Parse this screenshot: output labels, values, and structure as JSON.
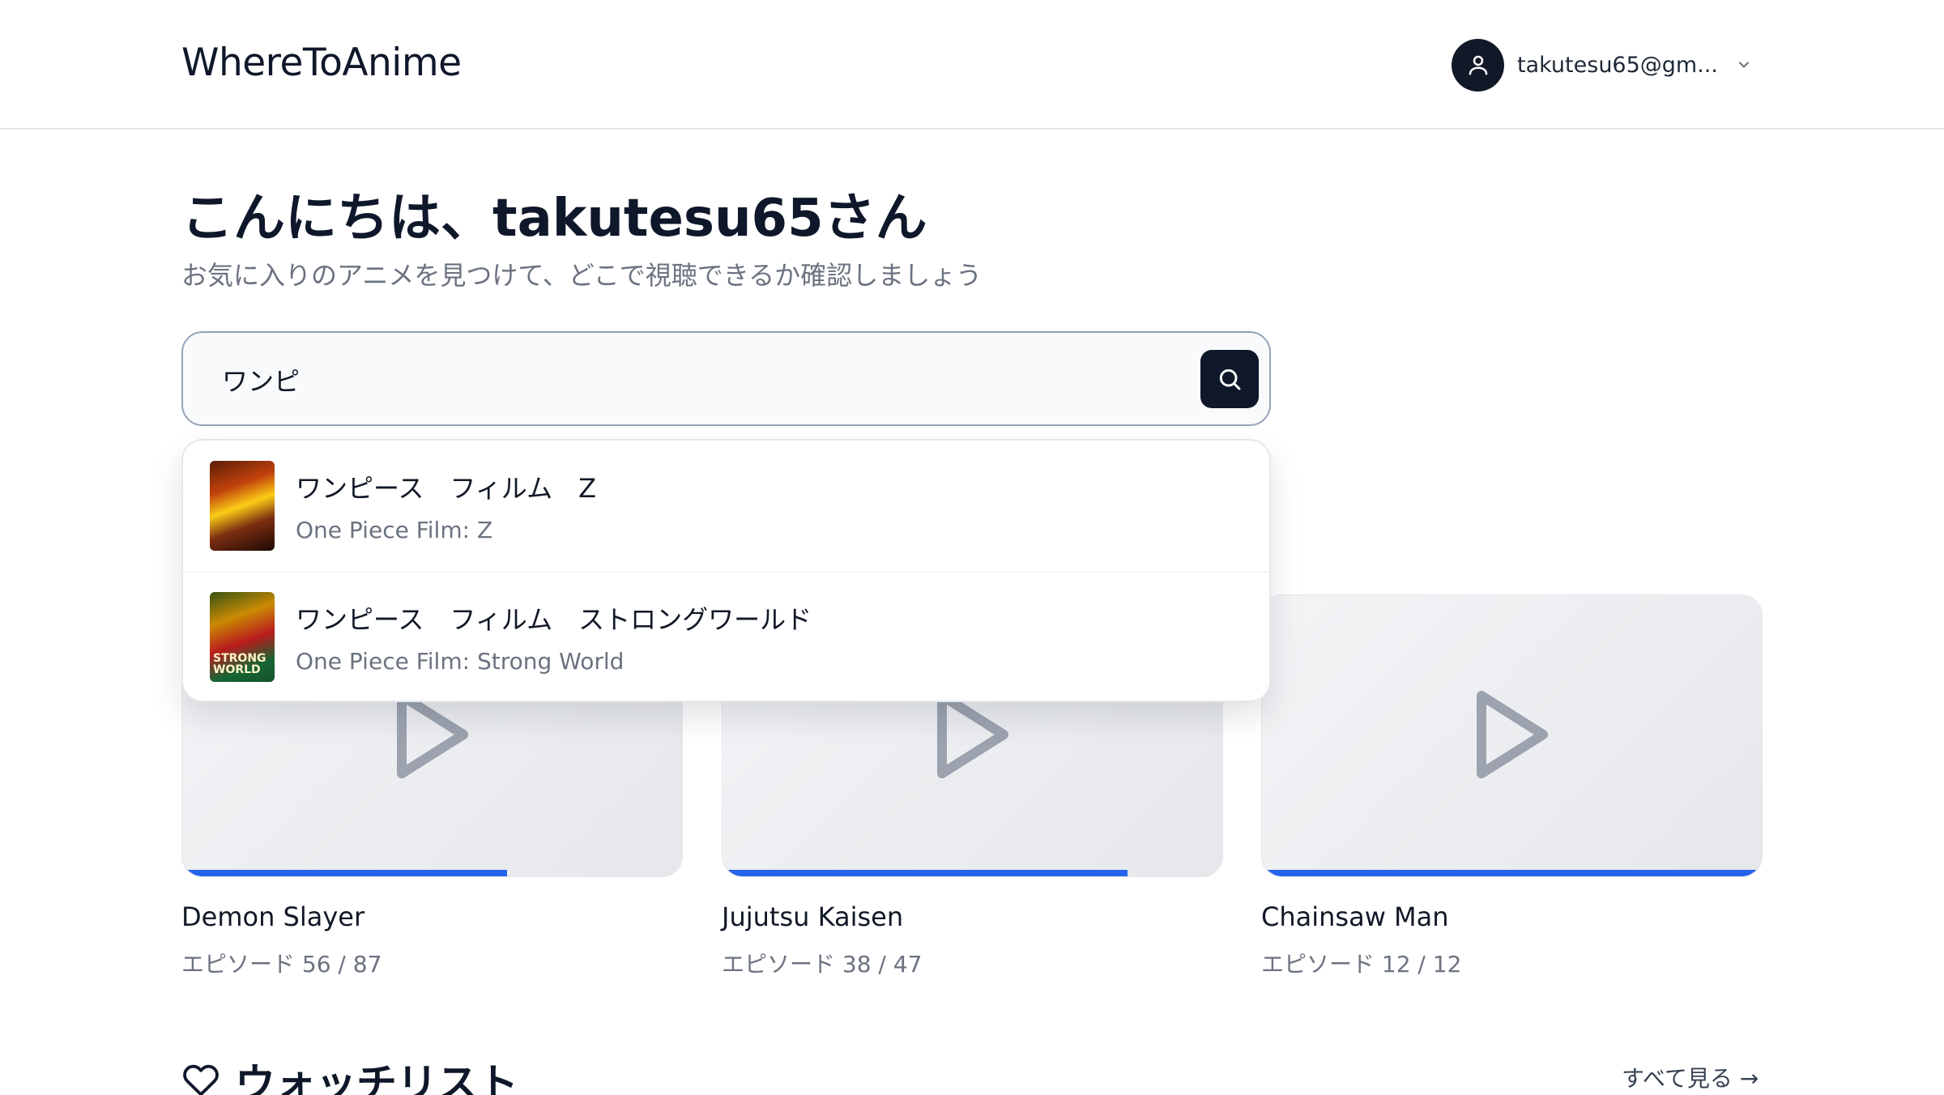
{
  "header": {
    "logo": "WhereToAnime",
    "user_email": "takutesu65@gm...",
    "icons": {
      "avatar": "user-icon",
      "chevron": "chevron-down-icon"
    }
  },
  "hero": {
    "greeting": "こんにちは、takutesu65さん",
    "subtitle": "お気に入りのアニメを見つけて、どこで視聴できるか確認しましょう"
  },
  "search": {
    "value": "ワンピ",
    "button_icon": "search-icon"
  },
  "suggestions": [
    {
      "title_ja": "ワンピース　フィルム　Z",
      "title_en": "One Piece Film: Z"
    },
    {
      "title_ja": "ワンピース　フィルム　ストロングワールド",
      "title_en": "One Piece Film: Strong World",
      "poster_text": "STRONG WORLD"
    }
  ],
  "continue_watching": [
    {
      "title": "Demon Slayer",
      "episodes": "エピソード 56 / 87",
      "progress": 0.65
    },
    {
      "title": "Jujutsu Kaisen",
      "episodes": "エピソード 38 / 47",
      "progress": 0.81
    },
    {
      "title": "Chainsaw Man",
      "episodes": "エピソード 12 / 12",
      "progress": 1.0
    }
  ],
  "watchlist": {
    "title": "ウォッチリスト",
    "see_all": "すべて見る →",
    "icon": "heart-icon"
  },
  "colors": {
    "accent": "#2563eb",
    "dark": "#0f172a",
    "muted": "#6b7280"
  }
}
